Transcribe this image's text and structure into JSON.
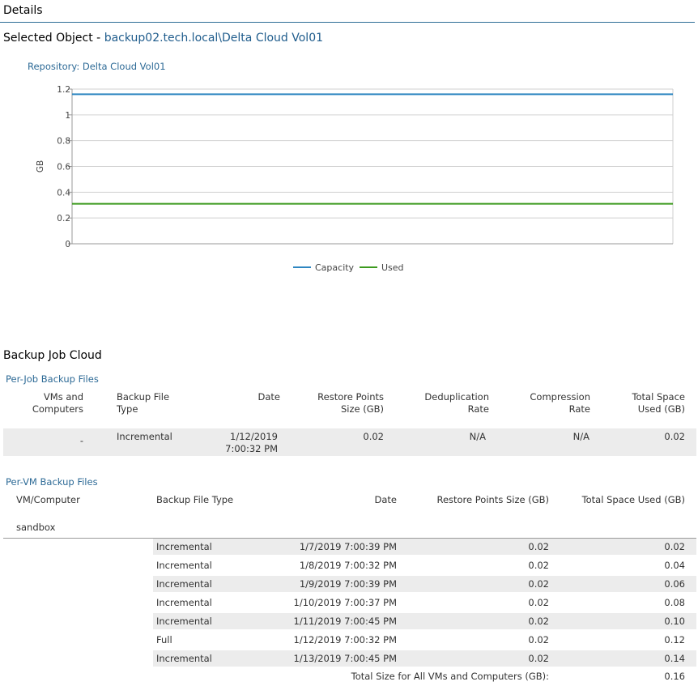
{
  "header": {
    "title": "Details"
  },
  "selected": {
    "label": "Selected Object - ",
    "value": "backup02.tech.local\\Delta Cloud Vol01"
  },
  "chart_data": {
    "type": "line",
    "title": "Repository: Delta Cloud Vol01",
    "ylabel": "GB",
    "xlabel": "",
    "ylim": [
      0,
      1.2
    ],
    "yticks": [
      "0",
      "0.2",
      "0.4",
      "0.6",
      "0.8",
      "1",
      "1.2"
    ],
    "grid": true,
    "legend": "bottom-center",
    "series": [
      {
        "name": "Capacity",
        "color": "#2e86c1",
        "values": [
          1.16,
          1.16
        ]
      },
      {
        "name": "Used",
        "color": "#3c9a1e",
        "values": [
          0.31,
          0.31
        ]
      }
    ]
  },
  "job": {
    "title": "Backup Job Cloud",
    "per_job": {
      "title": "Per-Job Backup Files",
      "headers": {
        "vms_1": "VMs and",
        "vms_2": "Computers",
        "type_1": "Backup File",
        "type_2": "Type",
        "date": "Date",
        "rps_1": "Restore Points",
        "rps_2": "Size (GB)",
        "dedup_1": "Deduplication",
        "dedup_2": "Rate",
        "comp_1": "Compression",
        "comp_2": "Rate",
        "total_1": "Total Space",
        "total_2": "Used (GB)"
      },
      "row": {
        "vms": "-",
        "type": "Incremental",
        "date_1": "1/12/2019",
        "date_2": "7:00:32 PM",
        "rps": "0.02",
        "dedup": "N/A",
        "comp": "N/A",
        "total": "0.02"
      }
    },
    "per_vm": {
      "title": "Per-VM Backup Files",
      "headers": {
        "vm": "VM/Computer",
        "type": "Backup File Type",
        "date": "Date",
        "rps": "Restore Points Size (GB)",
        "total": "Total Space Used (GB)"
      },
      "vm_name": "sandbox",
      "rows": [
        {
          "type": "Incremental",
          "date": "1/7/2019 7:00:39 PM",
          "rps": "0.02",
          "total": "0.02"
        },
        {
          "type": "Incremental",
          "date": "1/8/2019 7:00:32 PM",
          "rps": "0.02",
          "total": "0.04"
        },
        {
          "type": "Incremental",
          "date": "1/9/2019 7:00:39 PM",
          "rps": "0.02",
          "total": "0.06"
        },
        {
          "type": "Incremental",
          "date": "1/10/2019 7:00:37 PM",
          "rps": "0.02",
          "total": "0.08"
        },
        {
          "type": "Incremental",
          "date": "1/11/2019 7:00:45 PM",
          "rps": "0.02",
          "total": "0.10"
        },
        {
          "type": "Full",
          "date": "1/12/2019 7:00:32 PM",
          "rps": "0.02",
          "total": "0.12"
        },
        {
          "type": "Incremental",
          "date": "1/13/2019 7:00:45 PM",
          "rps": "0.02",
          "total": "0.14"
        }
      ],
      "total_label": "Total Size for All VMs and Computers (GB):",
      "total_value": "0.16"
    }
  }
}
